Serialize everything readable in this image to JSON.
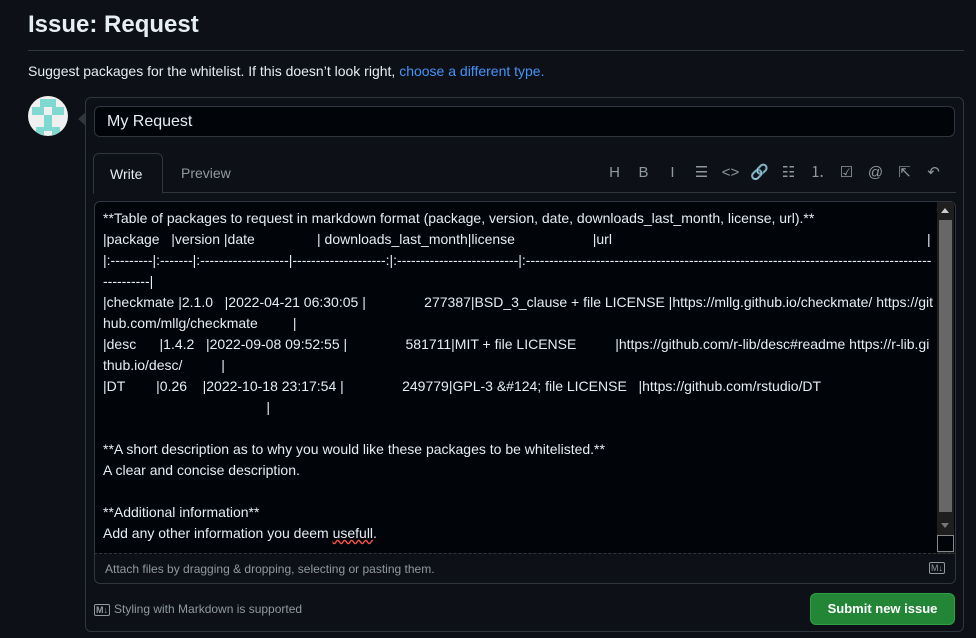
{
  "page": {
    "title": "Issue: Request",
    "subtitle": "Suggest packages for the whitelist. If this doesn’t look right, ",
    "subtitle_link": "choose a different type."
  },
  "form": {
    "title_value": "My Request",
    "tabs": [
      {
        "label": "Write",
        "active": true
      },
      {
        "label": "Preview",
        "active": false
      }
    ],
    "toolbar": [
      {
        "icon": "heading-icon",
        "glyph": "H"
      },
      {
        "icon": "bold-icon",
        "glyph": "B"
      },
      {
        "icon": "italic-icon",
        "glyph": "I"
      },
      {
        "icon": "quote-icon",
        "glyph": "☰"
      },
      {
        "icon": "code-icon",
        "glyph": "<>"
      },
      {
        "icon": "link-icon",
        "glyph": "🔗"
      },
      {
        "icon": "bulleted-list-icon",
        "glyph": "☷"
      },
      {
        "icon": "numbered-list-icon",
        "glyph": "⒈"
      },
      {
        "icon": "task-list-icon",
        "glyph": "☑"
      },
      {
        "icon": "mention-icon",
        "glyph": "@"
      },
      {
        "icon": "cross-reference-icon",
        "glyph": "⇱"
      },
      {
        "icon": "undo-icon",
        "glyph": "↶"
      }
    ],
    "body_text": "**Table of packages to request in markdown format (package, version, date, downloads_last_month, license, url).**\n|package   |version |date                | downloads_last_month|license                    |url                                                                                 |\n|:---------|:-------|:-------------------|--------------------:|:--------------------------|:-------------------------------------------------------------------------------------------------|\n|checkmate |2.1.0   |2022-04-21 06:30:05 |               277387|BSD_3_clause + file LICENSE |https://mllg.github.io/checkmate/ https://github.com/mllg/checkmate         |\n|desc      |1.4.2   |2022-09-08 09:52:55 |               581711|MIT + file LICENSE          |https://github.com/r-lib/desc#readme https://r-lib.github.io/desc/          |\n|DT        |0.26    |2022-10-18 23:17:54 |               249779|GPL-3 &#124; file LICENSE   |https://github.com/rstudio/DT                                                                      |\n\n**A short description as to why you would like these packages to be whitelisted.**\nA clear and concise description.\n\n**Additional information**\nAdd any other information you deem ",
    "body_misspelled": "usefull",
    "body_end": ".",
    "attach_hint": "Attach files by dragging & dropping, selecting or pasting them.",
    "markdown_note": "Styling with Markdown is supported",
    "markdown_badge": "M↓",
    "submit_label": "Submit new issue"
  },
  "colors": {
    "accent": "#4493f8",
    "submit": "#238636",
    "background": "#0d1117"
  }
}
